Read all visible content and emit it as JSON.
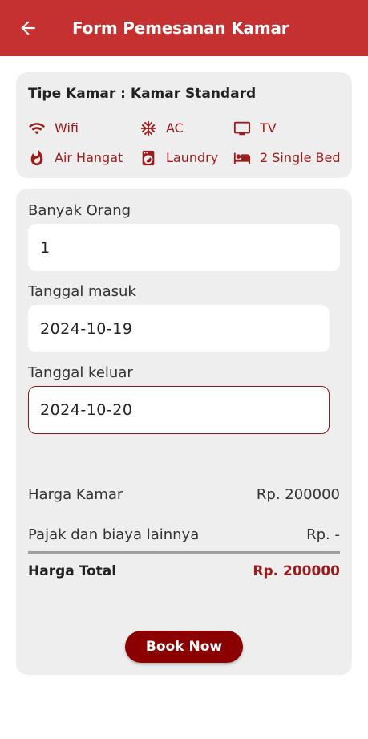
{
  "appbar": {
    "title": "Form Pemesanan Kamar",
    "back_icon": "arrow-left-icon",
    "color": "#c53030"
  },
  "room": {
    "type_label": "Tipe Kamar : Kamar Standard",
    "facilities": [
      {
        "icon": "wifi-icon",
        "label": "Wifi"
      },
      {
        "icon": "snowflake-icon",
        "label": "AC"
      },
      {
        "icon": "tv-icon",
        "label": "TV"
      },
      {
        "icon": "fire-icon",
        "label": "Air Hangat"
      },
      {
        "icon": "laundry-icon",
        "label": "Laundry"
      },
      {
        "icon": "bed-icon",
        "label": "2 Single Bed"
      }
    ],
    "accent_color": "#9b1c1c"
  },
  "form": {
    "people_label": "Banyak Orang",
    "people_value": "1",
    "checkin_label": "Tanggal masuk",
    "checkin_value": "2024-10-19",
    "checkout_label": "Tanggal keluar",
    "checkout_value": "2024-10-20"
  },
  "summary": {
    "room_price_label": "Harga Kamar",
    "room_price_value": "Rp. 200000",
    "tax_label": "Pajak dan biaya lainnya",
    "tax_value": "Rp. -",
    "total_label": "Harga Total",
    "total_value": "Rp. 200000"
  },
  "actions": {
    "book_label": "Book Now",
    "button_color": "#8b0000"
  }
}
